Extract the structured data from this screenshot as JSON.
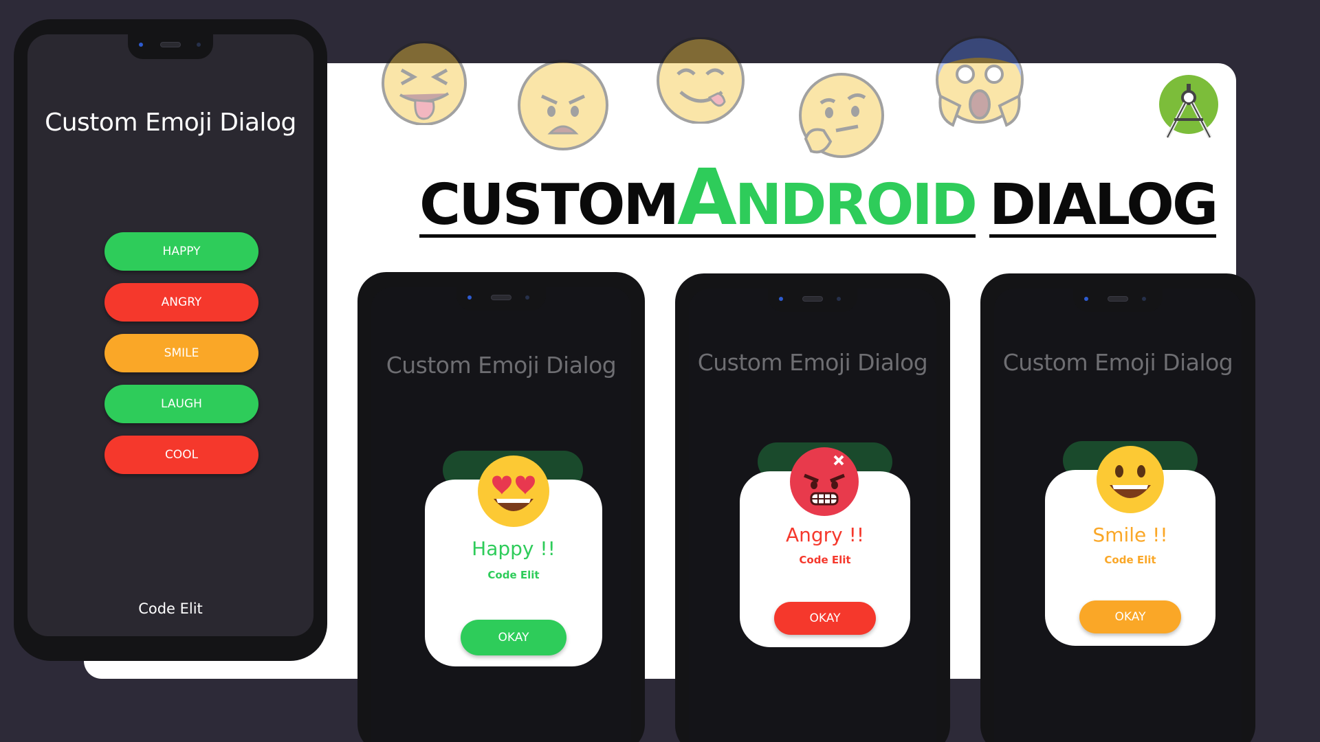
{
  "banner": {
    "headline_part1": "CUSTOM",
    "headline_accent_initial": "A",
    "headline_accent_rest": "NDROID",
    "headline_part3": "DIALOG",
    "accent_color": "#2ecc5a"
  },
  "decor_emojis": [
    "squint-tongue-emoji-icon",
    "angry-emoji-icon",
    "yum-emoji-icon",
    "thinking-emoji-icon",
    "scream-emoji-icon"
  ],
  "android_logo": "android-studio-logo-icon",
  "main_phone": {
    "title": "Custom Emoji Dialog",
    "buttons": [
      {
        "label": "HAPPY",
        "color": "#2ecc5a"
      },
      {
        "label": "ANGRY",
        "color": "#f5382c"
      },
      {
        "label": "SMILE",
        "color": "#faa727"
      },
      {
        "label": "LAUGH",
        "color": "#2ecc5a"
      },
      {
        "label": "COOL",
        "color": "#f5382c"
      }
    ],
    "footer": "Code Elit"
  },
  "dialog_phones": [
    {
      "title": "Custom Emoji Dialog",
      "dialog_title": "Happy !!",
      "dialog_sub": "Code Elit",
      "button": "OKAY",
      "color": "#2ecc5a",
      "emoji": "heart-eyes-emoji-icon"
    },
    {
      "title": "Custom Emoji Dialog",
      "dialog_title": "Angry !!",
      "dialog_sub": "Code Elit",
      "button": "OKAY",
      "color": "#f5382c",
      "emoji": "angry-red-emoji-icon"
    },
    {
      "title": "Custom Emoji Dialog",
      "dialog_title": "Smile !!",
      "dialog_sub": "Code Elit",
      "button": "OKAY",
      "color": "#faa727",
      "emoji": "grinning-emoji-icon"
    }
  ]
}
